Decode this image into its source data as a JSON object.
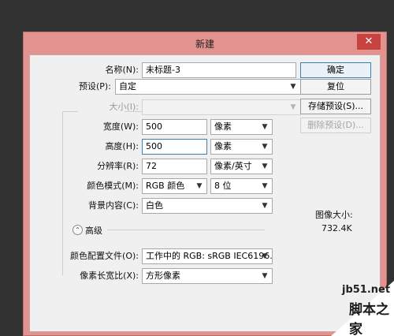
{
  "dialog": {
    "title": "新建",
    "close_label": "✕"
  },
  "form": {
    "name_label": "名称(N):",
    "name_value": "未标题-3",
    "preset_label": "预设(P):",
    "preset_value": "自定",
    "size_label": "大小(I):",
    "size_value": "",
    "width_label": "宽度(W):",
    "width_value": "500",
    "width_unit": "像素",
    "height_label": "高度(H):",
    "height_value": "500",
    "height_unit": "像素",
    "resolution_label": "分辨率(R):",
    "resolution_value": "72",
    "resolution_unit": "像素/英寸",
    "color_mode_label": "颜色模式(M):",
    "color_mode_value": "RGB 颜色",
    "bit_depth_value": "8 位",
    "background_label": "背景内容(C):",
    "background_value": "白色",
    "advanced_label": "高级",
    "color_profile_label": "颜色配置文件(O):",
    "color_profile_value": "工作中的 RGB: sRGB IEC6196...",
    "pixel_aspect_label": "像素长宽比(X):",
    "pixel_aspect_value": "方形像素"
  },
  "buttons": {
    "ok": "确定",
    "reset": "复位",
    "save_preset": "存储预设(S)...",
    "delete_preset": "删除预设(D)..."
  },
  "info": {
    "image_size_label": "图像大小:",
    "image_size_value": "732.4K"
  },
  "watermark": {
    "site": "jb51.net",
    "name": "脚本之家"
  },
  "colors": {
    "titlebar": "#e3938f",
    "close_button": "#c7433f",
    "client_bg": "#f0f0f0",
    "focus_border": "#3c7fb1"
  }
}
